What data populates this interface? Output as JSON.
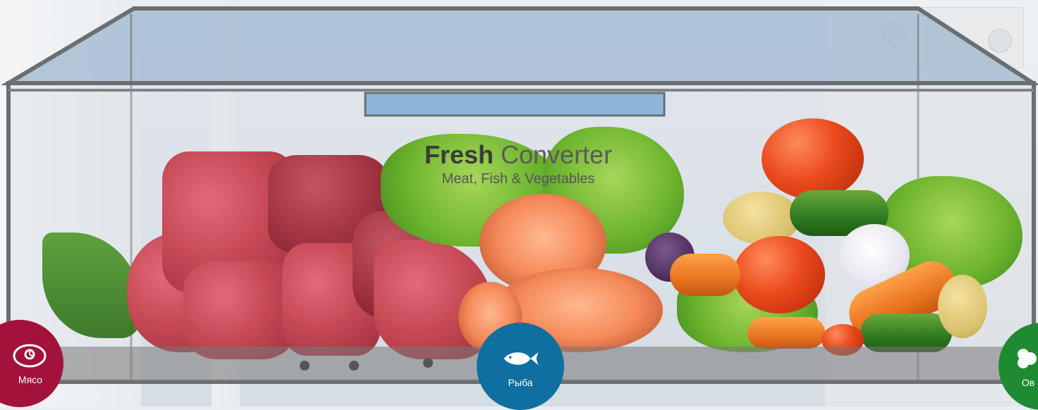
{
  "title": {
    "bold": "Fresh",
    "light": "Converter"
  },
  "subtitle": "Meat, Fish & Vegetables",
  "categories": [
    {
      "label": "Мясо",
      "icon": "meat-icon",
      "color": "#a3123a"
    },
    {
      "label": "Рыба",
      "icon": "fish-icon",
      "color": "#0e6fa0"
    },
    {
      "label": "Ов",
      "icon": "vegetable-icon",
      "color": "#1e8a31"
    }
  ],
  "colors": {
    "drawer_frame": "#6b6f72",
    "drawer_lid": "#9fb7cf",
    "handle": "#8fb6da"
  }
}
